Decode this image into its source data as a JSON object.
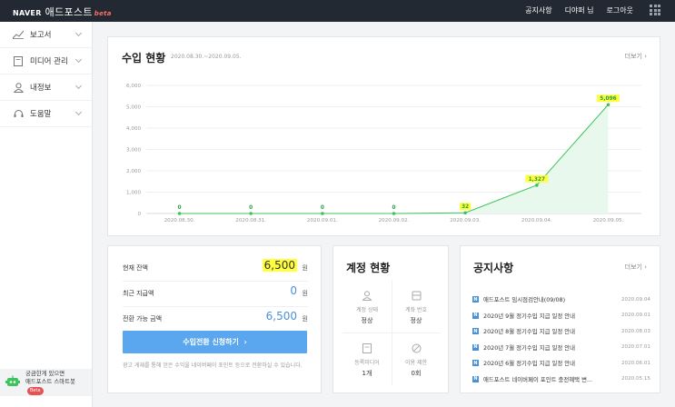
{
  "header": {
    "brand_naver": "NAVER",
    "brand_name": "애드포스트",
    "brand_badge": "beta",
    "nav": [
      "공지사항",
      "디야퍼 님",
      "로그아웃"
    ]
  },
  "sidebar": {
    "items": [
      {
        "label": "보고서",
        "icon": "chart-line-icon"
      },
      {
        "label": "미디어 관리",
        "icon": "document-icon"
      },
      {
        "label": "내정보",
        "icon": "user-icon"
      },
      {
        "label": "도움말",
        "icon": "headset-icon"
      }
    ],
    "bot_line1": "궁금한게 있으면",
    "bot_line2": "애드포스트 스마트봇",
    "bot_badge": "Beta"
  },
  "income": {
    "title": "수입 현황",
    "range": "2020.08.30.~2020.09.05.",
    "more": "더보기",
    "chart_data": {
      "type": "area",
      "categories": [
        "2020.08.30.",
        "2020.08.31.",
        "2020.09.01.",
        "2020.09.02.",
        "2020.09.03.",
        "2020.09.04.",
        "2020.09.05."
      ],
      "values": [
        0,
        0,
        0,
        0,
        32,
        1327,
        5096
      ],
      "value_labels": [
        "0",
        "0",
        "0",
        "0",
        "32",
        "1,327",
        "5,096"
      ],
      "yticks": [
        "0",
        "1,000",
        "2,000",
        "3,000",
        "4,000",
        "5,000",
        "6,000"
      ],
      "ylim": [
        0,
        6000
      ],
      "highlighted_labels": [
        4,
        5,
        6
      ],
      "color": "#3cc45a",
      "fill": "#e9f8ec"
    }
  },
  "balance": {
    "current_label": "현재 잔액",
    "current_value": "6,500",
    "recent_label": "최근 지급액",
    "recent_value": "0",
    "convertible_label": "전환 가능 금액",
    "convertible_value": "6,500",
    "unit": "원",
    "button": "수입전환 신청하기",
    "note": "광고 게재를 통해 얻은 수익을 네이버페이 포인트 등으로 전환하실 수 있습니다."
  },
  "account": {
    "title": "계정 현황",
    "cells": [
      {
        "label": "계정 상태",
        "value": "정상",
        "icon": "user-icon"
      },
      {
        "label": "계좌 번호",
        "value": "정상",
        "icon": "bank-icon"
      },
      {
        "label": "등록미디어",
        "value": "1개",
        "icon": "media-icon"
      },
      {
        "label": "이용 제한",
        "value": "0회",
        "icon": "block-icon"
      }
    ]
  },
  "notice": {
    "title": "공지사항",
    "more": "더보기",
    "items": [
      {
        "title": "애드포스트 임시점검안내(09/08)",
        "date": "2020.09.04"
      },
      {
        "title": "2020년 9월 정기수입 지급 일정 안내",
        "date": "2020.09.01"
      },
      {
        "title": "2020년 8월 정기수입 지급 일정 안내",
        "date": "2020.08.03"
      },
      {
        "title": "2020년 7월 정기수입 지급 일정 안내",
        "date": "2020.07.01"
      },
      {
        "title": "2020년 6월 정기수입 지급 일정 안내",
        "date": "2020.06.01"
      },
      {
        "title": "애드포스트 네이버페이 포인트 충전혜택 변...",
        "date": "2020.05.15"
      }
    ]
  }
}
